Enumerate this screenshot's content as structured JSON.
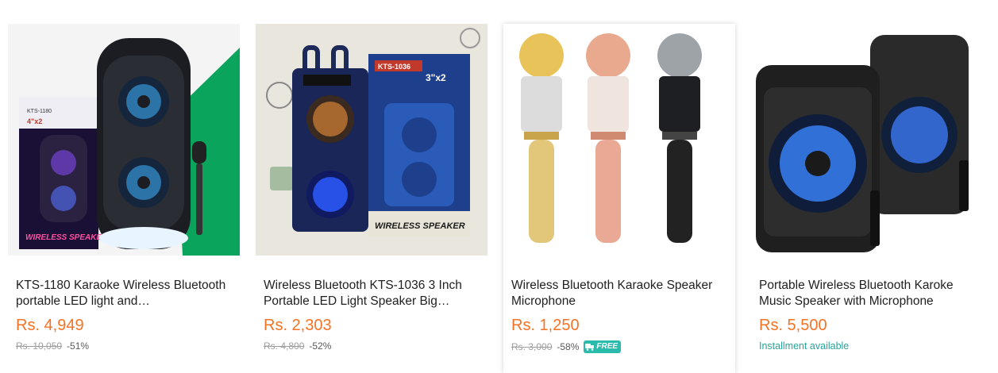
{
  "products": [
    {
      "title": "KTS-1180 Karaoke Wireless Bluetooth portable LED light and…",
      "price": "Rs. 4,949",
      "original_price": "Rs. 10,050",
      "discount": "-51%",
      "image_labels": {
        "box_model": "KTS-1180",
        "box_size": "4\"x2",
        "box_brand": "WIRELESS SPEAKER"
      }
    },
    {
      "title": "Wireless Bluetooth KTS-1036 3 Inch Portable LED Light Speaker Big…",
      "price": "Rs. 2,303",
      "original_price": "Rs. 4,800",
      "discount": "-52%",
      "image_labels": {
        "box_model": "KTS-1036",
        "box_size": "3\"x2",
        "box_brand": "WIRELESS SPEAKER"
      }
    },
    {
      "title": "Wireless Bluetooth Karaoke Speaker Microphone",
      "price": "Rs. 1,250",
      "original_price": "Rs. 3,000",
      "discount": "-58%",
      "free_badge": "FREE"
    },
    {
      "title": "Portable Wireless Bluetooth Karoke Music Speaker with Microphone",
      "price": "Rs. 5,500",
      "installment": "Installment available"
    }
  ],
  "colors": {
    "price": "#f57224",
    "installment": "#26a69a",
    "free_badge": "#2bbbad",
    "muted": "#9e9e9e"
  }
}
